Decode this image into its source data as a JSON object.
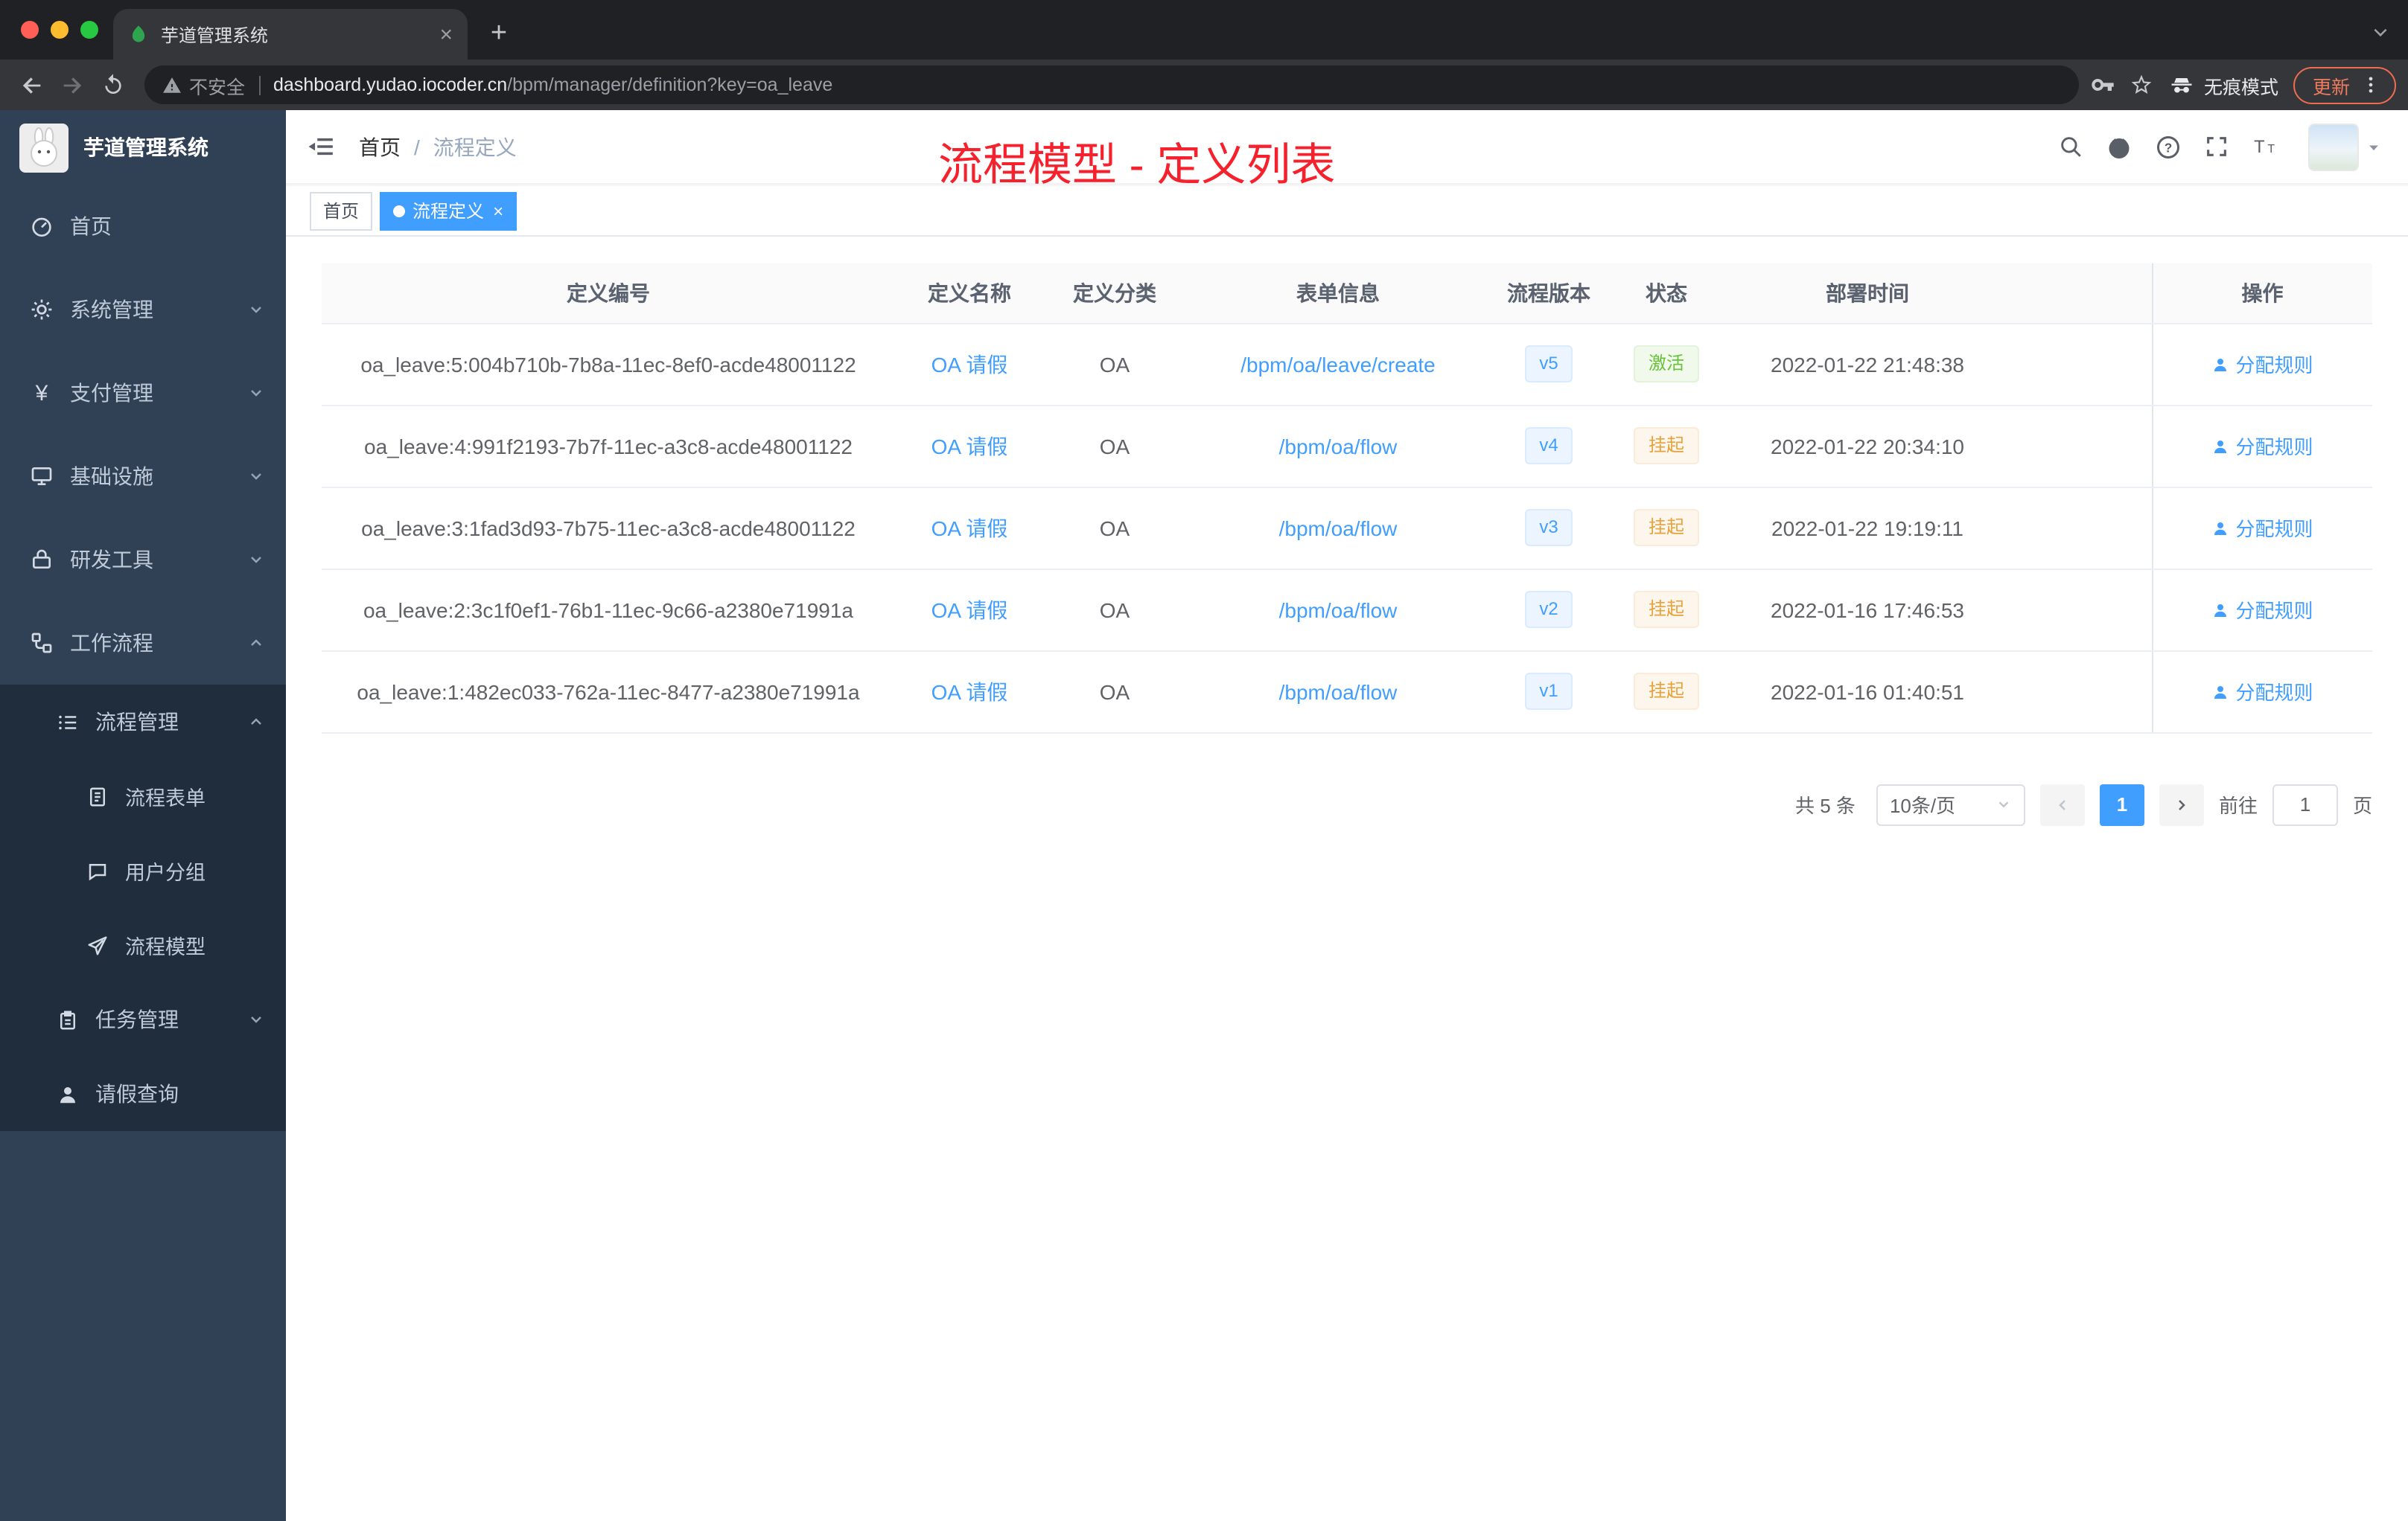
{
  "colors": {
    "accent": "#409EFF",
    "annotation_red": "#f5222d",
    "status_active_green": "#67c23a",
    "status_suspended_orange": "#e6a23c",
    "sidebar_bg": "#304156",
    "submenu_bg": "#1f2d3d",
    "chrome_bg": "#202124"
  },
  "browser": {
    "tab_title": "芋道管理系统",
    "security_label": "不安全",
    "url_domain": "dashboard.yudao.iocoder.cn",
    "url_path": "/bpm/manager/definition?key=oa_leave",
    "incognito_label": "无痕模式",
    "update_label": "更新"
  },
  "sidebar": {
    "logo_title": "芋道管理系统",
    "items": [
      {
        "label": "首页"
      },
      {
        "label": "系统管理"
      },
      {
        "label": "支付管理"
      },
      {
        "label": "基础设施"
      },
      {
        "label": "研发工具"
      },
      {
        "label": "工作流程"
      }
    ],
    "submenu": {
      "group_label": "流程管理",
      "children": [
        {
          "label": "流程表单"
        },
        {
          "label": "用户分组"
        },
        {
          "label": "流程模型"
        }
      ],
      "task_group_label": "任务管理",
      "leave_query_label": "请假查询"
    }
  },
  "header": {
    "breadcrumb": {
      "home": "首页",
      "separator": "/",
      "current": "流程定义"
    },
    "annotation": "流程模型 - 定义列表"
  },
  "tags": [
    {
      "label": "首页"
    },
    {
      "label": "流程定义"
    }
  ],
  "table": {
    "headers": [
      "定义编号",
      "定义名称",
      "定义分类",
      "表单信息",
      "流程版本",
      "状态",
      "部署时间",
      "操作"
    ],
    "rows": [
      {
        "id": "oa_leave:5:004b710b-7b8a-11ec-8ef0-acde48001122",
        "name": "OA 请假",
        "category": "OA",
        "form": "/bpm/oa/leave/create",
        "version": "v5",
        "status": "激活",
        "status_type": "active",
        "time": "2022-01-22 21:48:38",
        "action": "分配规则"
      },
      {
        "id": "oa_leave:4:991f2193-7b7f-11ec-a3c8-acde48001122",
        "name": "OA 请假",
        "category": "OA",
        "form": "/bpm/oa/flow",
        "version": "v4",
        "status": "挂起",
        "status_type": "suspended",
        "time": "2022-01-22 20:34:10",
        "action": "分配规则"
      },
      {
        "id": "oa_leave:3:1fad3d93-7b75-11ec-a3c8-acde48001122",
        "name": "OA 请假",
        "category": "OA",
        "form": "/bpm/oa/flow",
        "version": "v3",
        "status": "挂起",
        "status_type": "suspended",
        "time": "2022-01-22 19:19:11",
        "action": "分配规则"
      },
      {
        "id": "oa_leave:2:3c1f0ef1-76b1-11ec-9c66-a2380e71991a",
        "name": "OA 请假",
        "category": "OA",
        "form": "/bpm/oa/flow",
        "version": "v2",
        "status": "挂起",
        "status_type": "suspended",
        "time": "2022-01-16 17:46:53",
        "action": "分配规则"
      },
      {
        "id": "oa_leave:1:482ec033-762a-11ec-8477-a2380e71991a",
        "name": "OA 请假",
        "category": "OA",
        "form": "/bpm/oa/flow",
        "version": "v1",
        "status": "挂起",
        "status_type": "suspended",
        "time": "2022-01-16 01:40:51",
        "action": "分配规则"
      }
    ]
  },
  "pagination": {
    "total_label": "共 5 条",
    "page_size_label": "10条/页",
    "current_page": "1",
    "goto_label": "前往",
    "goto_value": "1",
    "page_unit_label": "页"
  }
}
